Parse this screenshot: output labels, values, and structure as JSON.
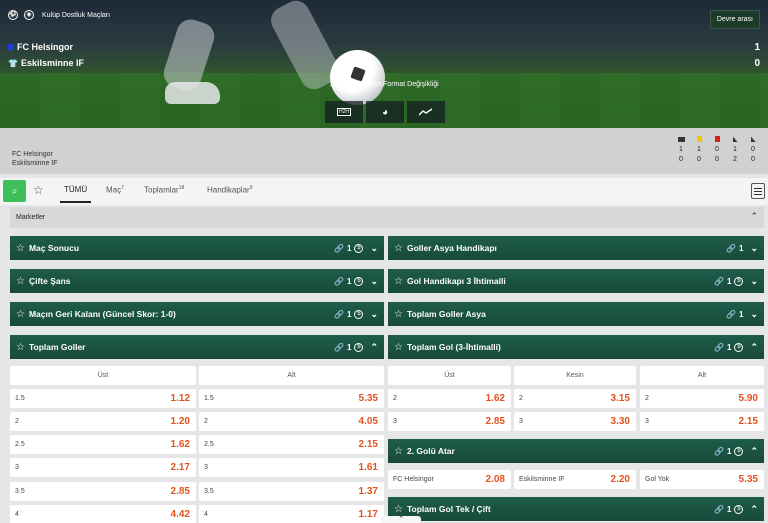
{
  "hero": {
    "competition": "Kulüp Dostluk Maçları",
    "halftime_button": "Devre arası",
    "home_team": "FC Helsingor",
    "away_team": "Eskilsminne IF",
    "home_score": "1",
    "away_score": "0",
    "info": "1 - 0, (1:0) Class Format Değişikliği",
    "tools": [
      "h2h-icon",
      "stats-pie-icon",
      "trend-line-icon"
    ],
    "h2h_label": "H2H"
  },
  "stats": {
    "home": "FC Helsingor",
    "away": "Eskilsminne IF",
    "icons": [
      "corner-card-icon",
      "yellow-card-icon",
      "red-card-icon",
      "corner-flag-icon",
      "corner-flag-icon"
    ],
    "icon_colors": [
      "#333333",
      "#f2c500",
      "#d6201f",
      "#333333",
      "#333333"
    ],
    "home_values": [
      "1",
      "1",
      "0",
      "1",
      "0"
    ],
    "away_values": [
      "0",
      "0",
      "0",
      "2",
      "0"
    ]
  },
  "tabs": [
    {
      "label": "TÜMÜ",
      "count": ""
    },
    {
      "label": "Maç",
      "count": "7"
    },
    {
      "label": "Toplamlar",
      "count": "18"
    },
    {
      "label": "Handikaplar",
      "count": "9"
    }
  ],
  "markets_header": "Marketler",
  "markets": {
    "mac_sonucu": {
      "title": "Maç Sonucu",
      "count": "1"
    },
    "goller_asya": {
      "title": "Goller Asya Handikapı",
      "count": "1"
    },
    "cifte_sans": {
      "title": "Çifte Şans",
      "count": "1"
    },
    "gol_handikap3": {
      "title": "Gol Handikapı 3 İhtimalli",
      "count": "1"
    },
    "geri_kalani": {
      "title": "Maçın Geri Kalanı (Güncel Skor: 1-0)",
      "count": "1"
    },
    "toplam_asya": {
      "title": "Toplam Goller Asya",
      "count": "1"
    },
    "toplam_goller": {
      "title": "Toplam Goller",
      "count": "1",
      "headers": [
        "Üst",
        "Alt"
      ],
      "rows": [
        {
          "line": "1.5",
          "over": "1.12",
          "under": "5.35"
        },
        {
          "line": "2",
          "over": "1.20",
          "under": "4.05"
        },
        {
          "line": "2.5",
          "over": "1.62",
          "under": "2.15"
        },
        {
          "line": "3",
          "over": "2.17",
          "under": "1.61"
        },
        {
          "line": "3.5",
          "over": "2.85",
          "under": "1.37"
        },
        {
          "line": "4",
          "over": "4.42",
          "under": "1.17"
        }
      ]
    },
    "toplam_gol3": {
      "title": "Toplam Gol (3-İhtimalli)",
      "count": "1",
      "headers": [
        "Üst",
        "Kesin",
        "Alt"
      ],
      "rows": [
        {
          "line": "2",
          "a": "1.62",
          "b": "3.15",
          "c": "5.90"
        },
        {
          "line": "3",
          "a": "2.85",
          "b": "3.30",
          "c": "2.15"
        }
      ]
    },
    "golu_atar": {
      "title": "2. Golü Atar",
      "count": "1",
      "options": [
        {
          "label": "FC Helsingor",
          "odd": "2.08"
        },
        {
          "label": "Eskilsminne IF",
          "odd": "2.20"
        },
        {
          "label": "Gol Yok",
          "odd": "5.35"
        }
      ]
    },
    "tek_cift": {
      "title": "Toplam Gol Tek / Çift",
      "count": "1"
    }
  }
}
